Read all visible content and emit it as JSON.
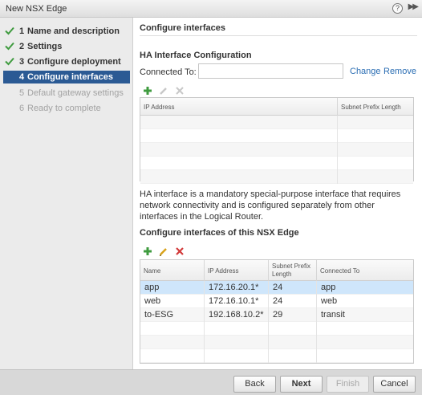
{
  "window": {
    "title": "New NSX Edge"
  },
  "steps": [
    {
      "num": "1",
      "label": "Name and description",
      "state": "done"
    },
    {
      "num": "2",
      "label": "Settings",
      "state": "done"
    },
    {
      "num": "3",
      "label": "Configure deployment",
      "state": "done"
    },
    {
      "num": "4",
      "label": "Configure interfaces",
      "state": "active"
    },
    {
      "num": "5",
      "label": "Default gateway settings",
      "state": "disabled"
    },
    {
      "num": "6",
      "label": "Ready to complete",
      "state": "disabled"
    }
  ],
  "main": {
    "title": "Configure interfaces",
    "ha": {
      "title": "HA Interface Configuration",
      "connected_label": "Connected To:",
      "connected_value": "",
      "change": "Change",
      "remove": "Remove",
      "columns": [
        "IP Address",
        "Subnet Prefix Length"
      ],
      "note": "HA interface is a mandatory special-purpose interface that requires network connectivity and is configured separately from other interfaces in the Logical Router."
    },
    "edge": {
      "title": "Configure interfaces of this NSX Edge",
      "columns": [
        "Name",
        "IP Address",
        "Subnet Prefix Length",
        "Connected To"
      ],
      "rows": [
        {
          "name": "app",
          "ip": "172.16.20.1*",
          "prefix": "24",
          "connected": "app"
        },
        {
          "name": "web",
          "ip": "172.16.10.1*",
          "prefix": "24",
          "connected": "web"
        },
        {
          "name": "to-ESG",
          "ip": "192.168.10.2*",
          "prefix": "29",
          "connected": "transit"
        }
      ]
    }
  },
  "footer": {
    "back": "Back",
    "next": "Next",
    "finish": "Finish",
    "cancel": "Cancel"
  },
  "colors": {
    "accent": "#2b5a94",
    "check": "#3f9b3f",
    "link": "#2a6db3",
    "delete": "#d23b3b",
    "edit": "#d9a21a"
  }
}
